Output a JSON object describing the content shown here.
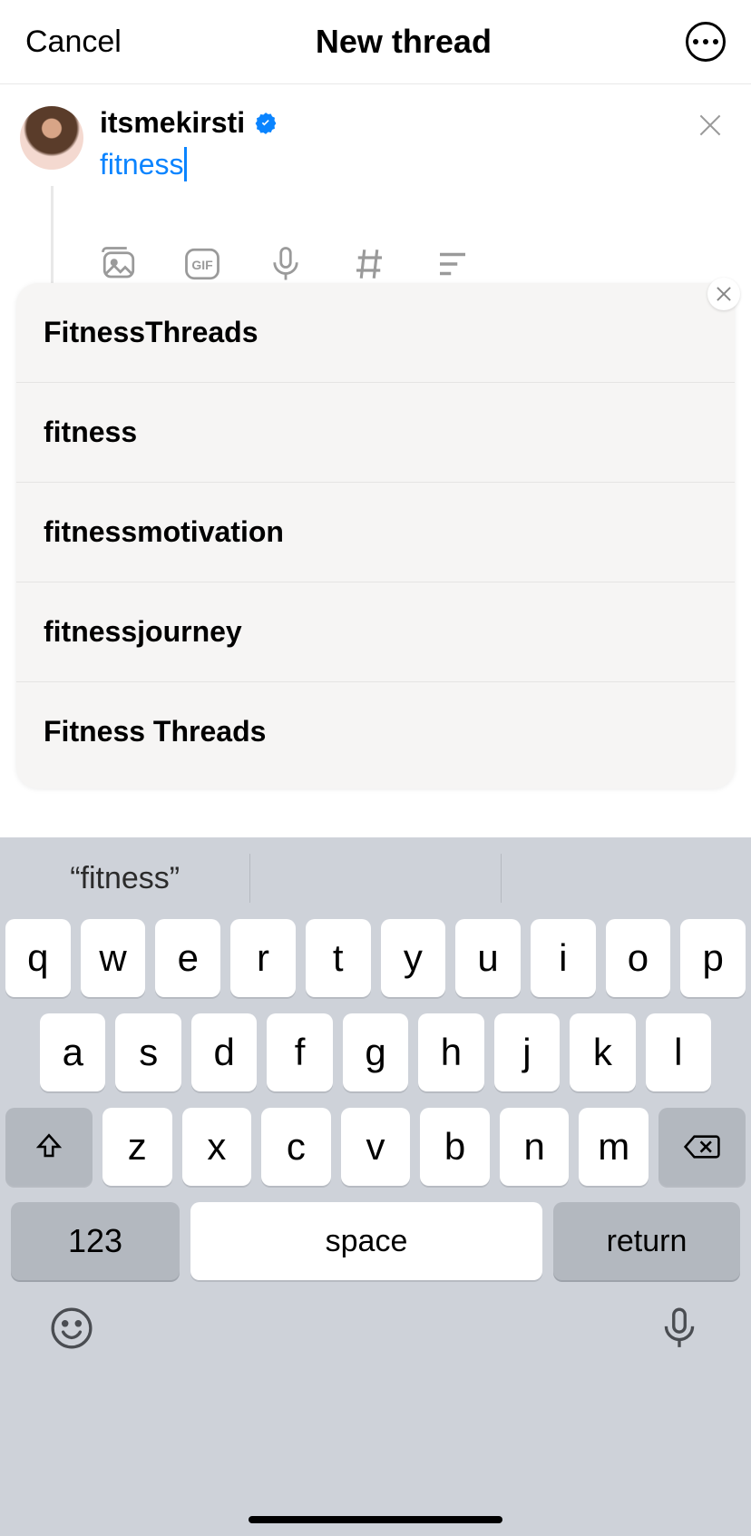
{
  "header": {
    "cancel": "Cancel",
    "title": "New thread"
  },
  "compose": {
    "username": "itsmekirsti",
    "typed_text": "fitness"
  },
  "suggestions": [
    "FitnessThreads",
    "fitness",
    "fitnessmotivation",
    "fitnessjourney",
    "Fitness Threads"
  ],
  "keyboard": {
    "prediction": "“fitness”",
    "row1": [
      "q",
      "w",
      "e",
      "r",
      "t",
      "y",
      "u",
      "i",
      "o",
      "p"
    ],
    "row2": [
      "a",
      "s",
      "d",
      "f",
      "g",
      "h",
      "j",
      "k",
      "l"
    ],
    "row3": [
      "z",
      "x",
      "c",
      "v",
      "b",
      "n",
      "m"
    ],
    "numkey": "123",
    "space": "space",
    "return": "return"
  }
}
